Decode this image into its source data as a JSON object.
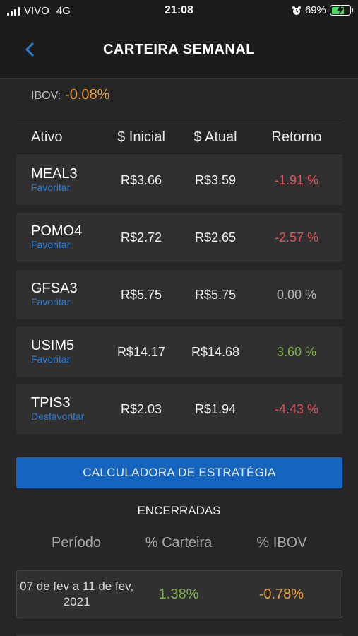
{
  "status_bar": {
    "carrier": "VIVO",
    "network": "4G",
    "time": "21:08",
    "battery": "69%",
    "battery_level": 0.69
  },
  "header": {
    "title": "CARTEIRA SEMANAL",
    "back_icon": "chevron-left-icon"
  },
  "ibov": {
    "label": "IBOV:",
    "value": "-0.08%"
  },
  "table": {
    "headers": {
      "ativo": "Ativo",
      "inicial": "$ Inicial",
      "atual": "$ Atual",
      "retorno": "Retorno"
    },
    "rows": [
      {
        "ticker": "MEAL3",
        "fav": "Favoritar",
        "inicial": "R$3.66",
        "atual": "R$3.59",
        "retorno": "-1.91 %",
        "trend": "negative"
      },
      {
        "ticker": "POMO4",
        "fav": "Favoritar",
        "inicial": "R$2.72",
        "atual": "R$2.65",
        "retorno": "-2.57 %",
        "trend": "negative"
      },
      {
        "ticker": "GFSA3",
        "fav": "Favoritar",
        "inicial": "R$5.75",
        "atual": "R$5.75",
        "retorno": "0.00 %",
        "trend": "neutral"
      },
      {
        "ticker": "USIM5",
        "fav": "Favoritar",
        "inicial": "R$14.17",
        "atual": "R$14.68",
        "retorno": "3.60 %",
        "trend": "positive"
      },
      {
        "ticker": "TPIS3",
        "fav": "Desfavoritar",
        "inicial": "R$2.03",
        "atual": "R$1.94",
        "retorno": "-4.43 %",
        "trend": "negative"
      }
    ]
  },
  "calc_button": "CALCULADORA DE ESTRATÉGIA",
  "closed": {
    "title": "ENCERRADAS",
    "headers": {
      "periodo": "Período",
      "carteira": "% Carteira",
      "ibov": "% IBOV"
    },
    "rows": [
      {
        "periodo": "07 de fev a 11 de fev, 2021",
        "carteira": "1.38%",
        "ibov": "-0.78%"
      }
    ]
  },
  "colors": {
    "negative": "#e0525a",
    "positive": "#7fb04a",
    "neutral": "#b5b5b5",
    "warning": "#f0a33a",
    "accent": "#1565c0",
    "link": "#2f7fd6"
  }
}
